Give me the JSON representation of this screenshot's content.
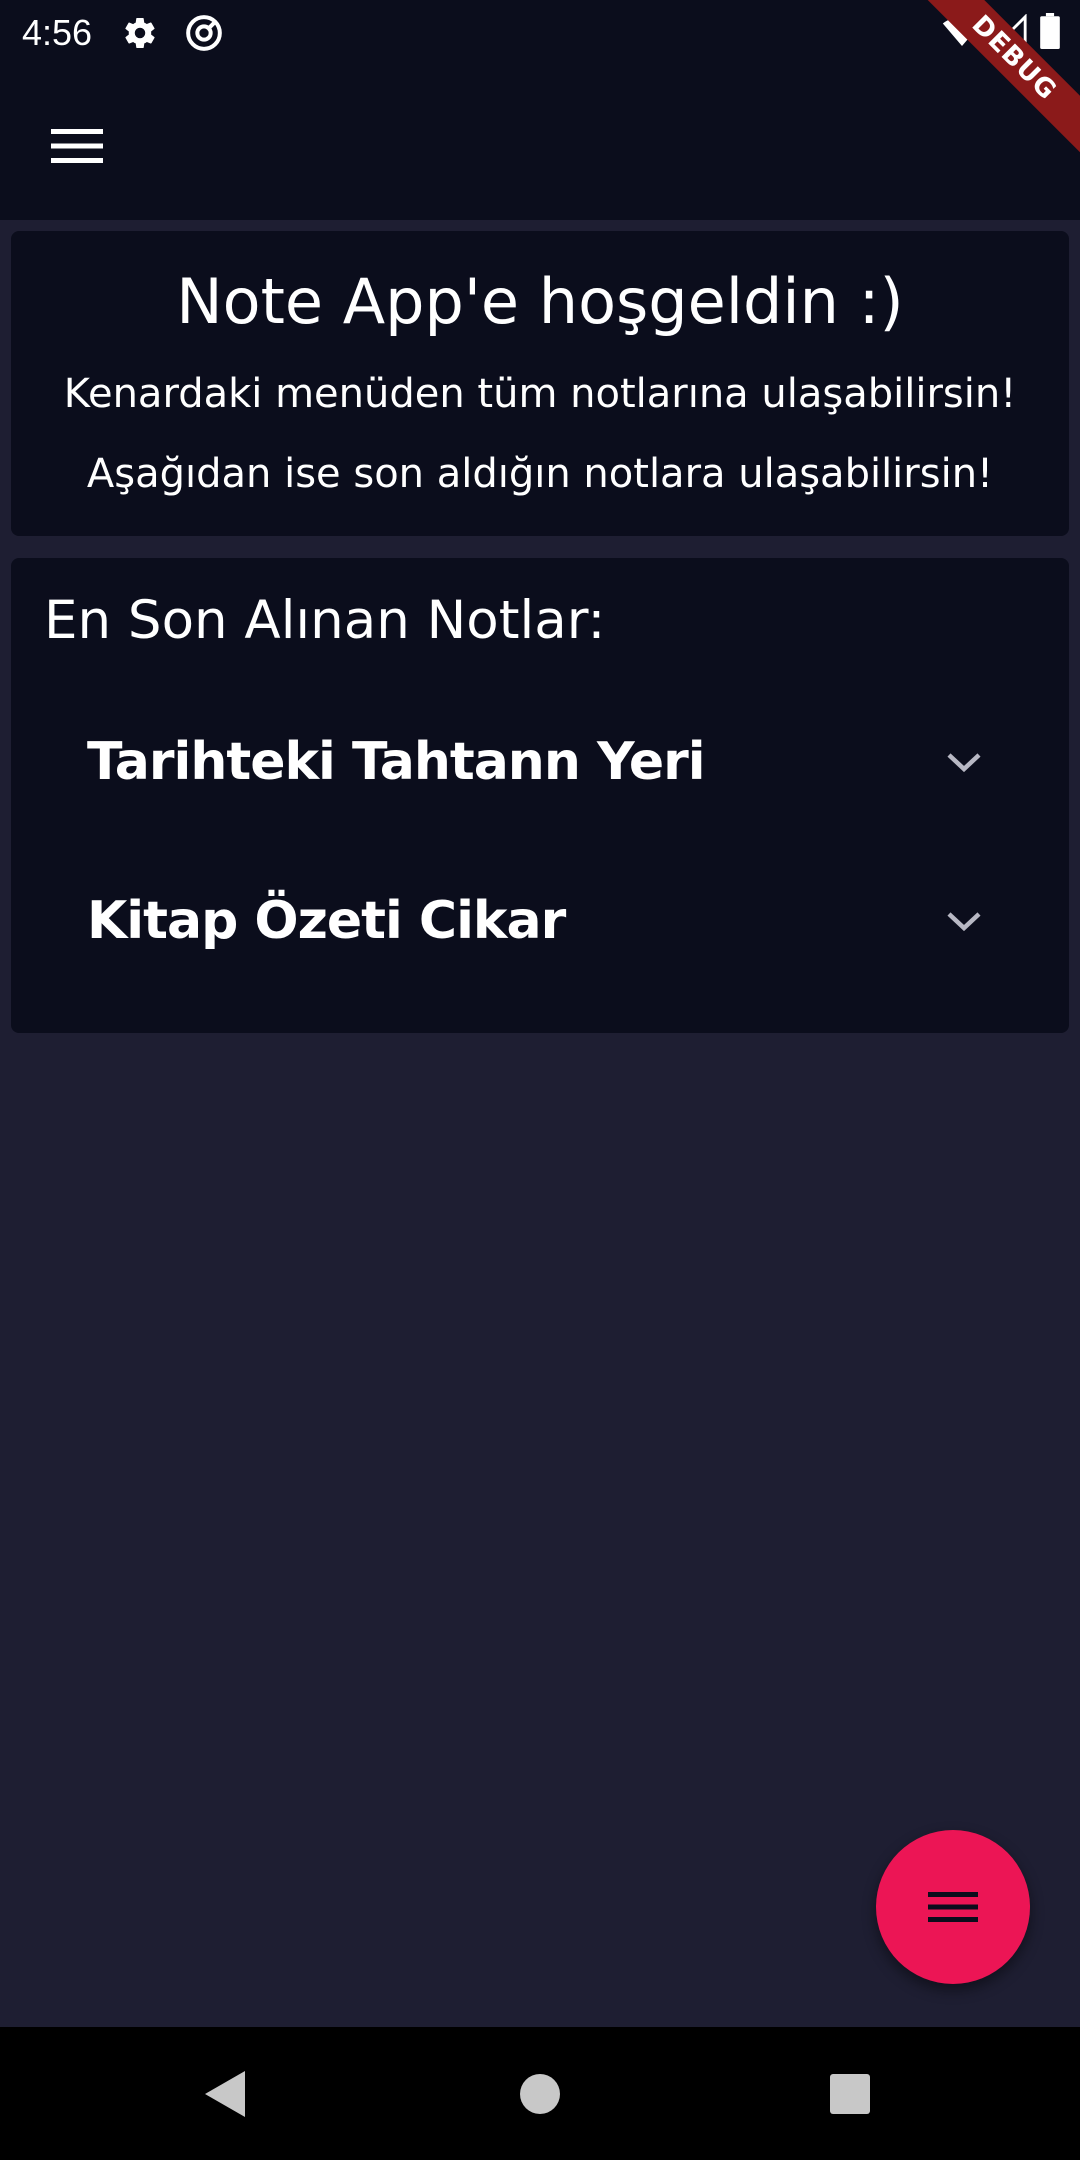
{
  "status_bar": {
    "time": "4:56",
    "left_icons": [
      "settings-gear-icon",
      "sync-at-icon"
    ],
    "right_icons": [
      "wifi-icon",
      "cell-signal-icon",
      "battery-icon"
    ]
  },
  "debug_banner": {
    "label": "DEBUG"
  },
  "app_bar": {
    "menu_icon": "hamburger-menu-icon"
  },
  "welcome_card": {
    "title": "Note App'e hoşgeldin :)",
    "line1": "Kenardaki menüden tüm notlarına ulaşabilirsin!",
    "line2": "Aşağıdan ise son aldığın notlara ulaşabilirsin!"
  },
  "recent_notes": {
    "heading": "En Son Alınan Notlar:",
    "items": [
      {
        "title": "Tarihteki Tahtann Yeri",
        "icon": "chevron-down-icon"
      },
      {
        "title": "Kitap Özeti Cikar",
        "icon": "chevron-down-icon"
      }
    ]
  },
  "fab": {
    "icon": "menu-lines-icon"
  },
  "nav_bar": {
    "icons": [
      "back-triangle-icon",
      "home-circle-icon",
      "recents-square-icon"
    ]
  },
  "colors": {
    "background": "#1e1e32",
    "surface": "#0b0d1c",
    "accent": "#ec1555",
    "debug": "#8b1a1a"
  }
}
